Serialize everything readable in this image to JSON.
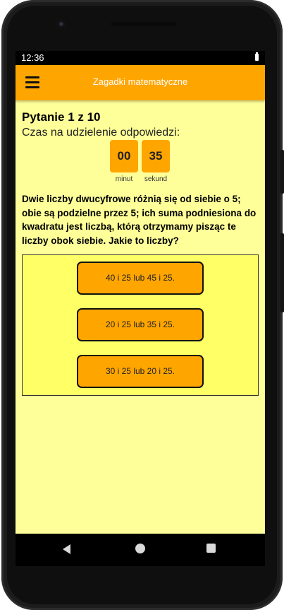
{
  "status_bar": {
    "time": "12:36"
  },
  "app_bar": {
    "title": "Zagadki matematyczne"
  },
  "quiz": {
    "question_counter": "Pytanie 1 z 10",
    "time_label": "Czas na udzielenie odpowiedzi:",
    "timer": {
      "minutes": "00",
      "minutes_label": "minut",
      "seconds": "35",
      "seconds_label": "sekund"
    },
    "question": "Dwie liczby dwucyfrowe różnią się od siebie o 5; obie są podzielne przez 5; ich suma podniesiona do kwadratu jest liczbą, którą otrzymamy pisząc te liczby obok siebie. Jakie to liczby?",
    "answers": [
      "40 i 25 lub 45 i 25.",
      "20 i 25 lub 35 i 25.",
      "30 i 25 lub 20 i 25."
    ]
  },
  "colors": {
    "accent": "#ffa500",
    "background": "#ffff99",
    "answers_panel": "#ffff66"
  },
  "icons": {
    "menu": "hamburger-menu-icon",
    "back": "back-triangle-icon",
    "home": "home-circle-icon",
    "recents": "recents-square-icon"
  }
}
